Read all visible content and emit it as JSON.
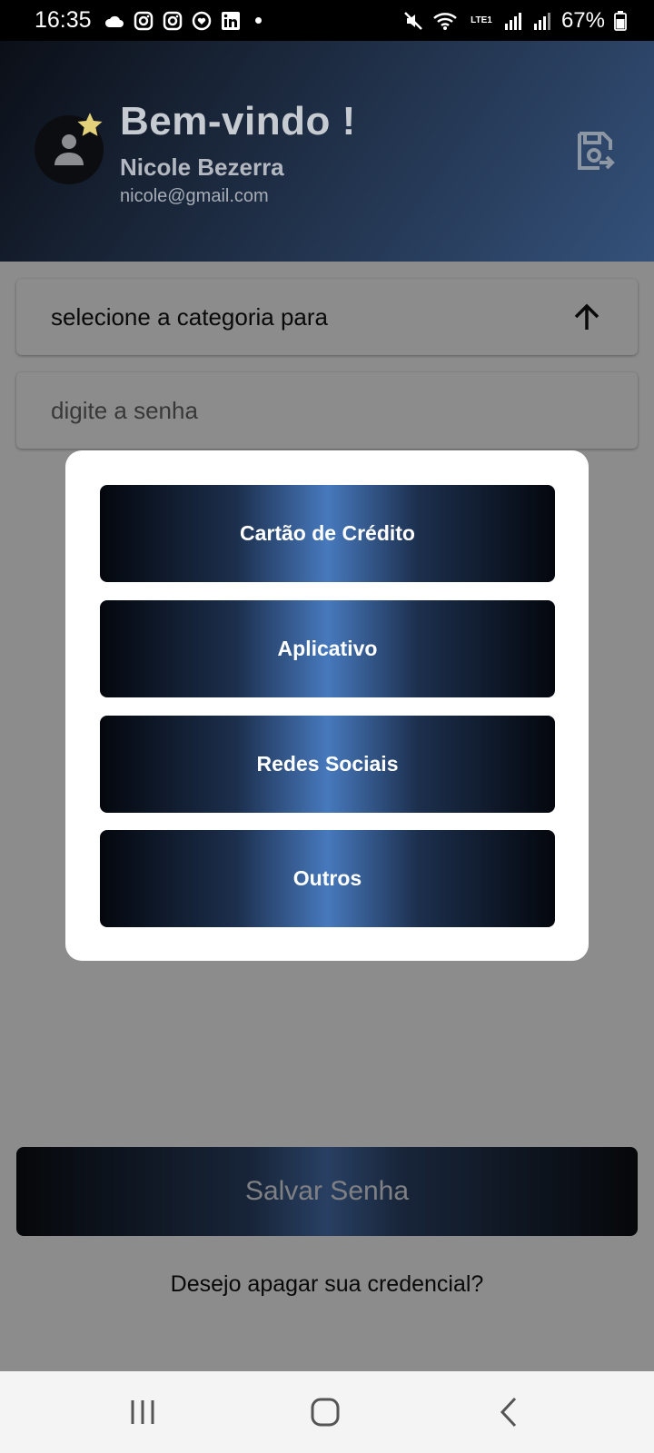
{
  "status_bar": {
    "time": "16:35",
    "battery": "67%",
    "left_icons": [
      "cloud-icon",
      "instagram-icon",
      "instagram-icon",
      "heart-chat-icon",
      "linkedin-icon",
      "dot-icon"
    ],
    "right_icons": [
      "mute-icon",
      "wifi-icon",
      "lte-icon",
      "signal-icon",
      "signal-icon",
      "battery-icon"
    ],
    "lte_label": "LTE1"
  },
  "header": {
    "welcome": "Bem-vindo !",
    "user_name": "Nicole Bezerra",
    "user_email": "nicole@gmail.com"
  },
  "form": {
    "category_placeholder": "selecione a categoria para",
    "password_placeholder": "digite a senha",
    "save_button": "Salvar Senha",
    "delete_link": "Desejo apagar sua credencial?"
  },
  "category_modal": {
    "options": [
      "Cartão de Crédito",
      "Aplicativo",
      "Redes Sociais",
      "Outros"
    ]
  },
  "colors": {
    "accent_blue": "#4779bd",
    "header_dark": "#0b0f17",
    "star_gold": "#e3d27a"
  }
}
